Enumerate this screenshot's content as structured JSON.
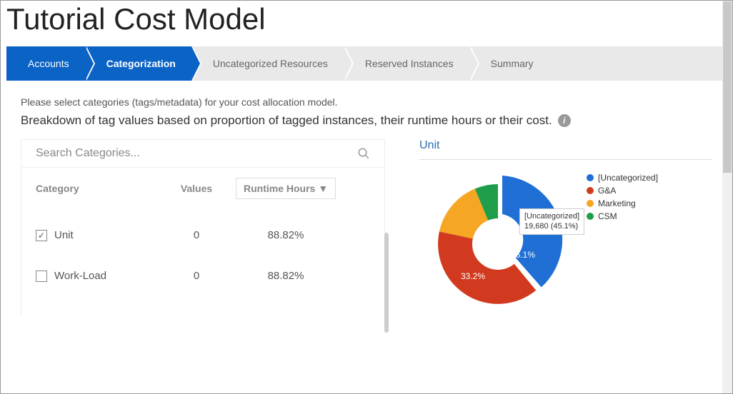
{
  "title": "Tutorial Cost Model",
  "stepper": {
    "items": [
      "Accounts",
      "Categorization",
      "Uncategorized Resources",
      "Reserved Instances",
      "Summary"
    ],
    "active_index": 1
  },
  "instruction1": "Please select categories (tags/metadata) for your cost allocation model.",
  "instruction2": "Breakdown of tag values based on proportion of tagged instances, their runtime hours or their cost.",
  "search": {
    "placeholder": "Search Categories..."
  },
  "table": {
    "headers": {
      "category": "Category",
      "values": "Values",
      "runtime": "Runtime Hours"
    },
    "rows": [
      {
        "checked": true,
        "label": "Unit",
        "values": "0",
        "runtime": "88.82%"
      },
      {
        "checked": false,
        "label": "Work-Load",
        "values": "0",
        "runtime": "88.82%"
      }
    ]
  },
  "chart_title": "Unit",
  "chart_data": {
    "type": "pie",
    "title": "Unit",
    "series": [
      {
        "name": "[Uncategorized]",
        "value": 19680,
        "percent": 45.1,
        "color": "#1f6fd4"
      },
      {
        "name": "G&A",
        "value": null,
        "percent": 33.2,
        "color": "#d23a1f"
      },
      {
        "name": "Marketing",
        "value": null,
        "percent": 14.0,
        "color": "#f5a623"
      },
      {
        "name": "CSM",
        "value": null,
        "percent": 7.7,
        "color": "#1e9e4a"
      }
    ],
    "tooltip": {
      "label": "[Uncategorized]",
      "value": "19,680 (45.1%)"
    },
    "visible_labels": {
      "uncat": "45.1%",
      "ga": "33.2%"
    }
  },
  "colors": {
    "accent": "#0b63c6"
  }
}
